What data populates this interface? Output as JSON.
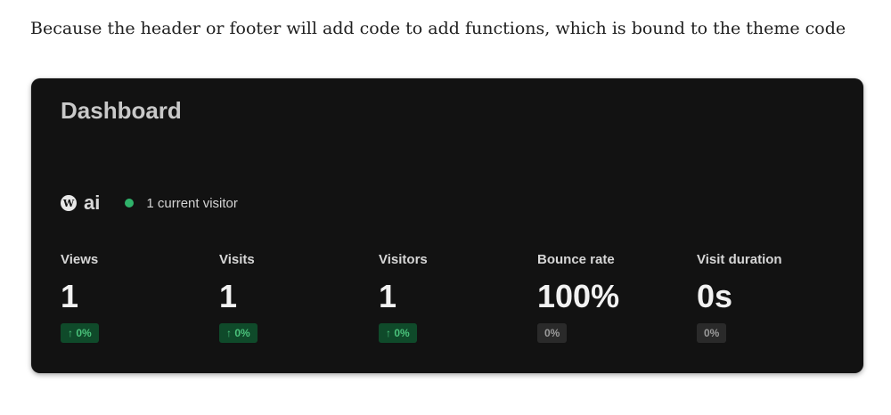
{
  "intro_text": "Because the header or footer will add code to add functions, which is bound to the theme code",
  "dashboard": {
    "title": "Dashboard",
    "site": {
      "icon": "wordpress-icon",
      "name": "ai"
    },
    "live": {
      "dot_color": "#2fb26a",
      "text": "1 current visitor"
    },
    "stats": [
      {
        "label": "Views",
        "value": "1",
        "change": "↑ 0%",
        "trend": "up"
      },
      {
        "label": "Visits",
        "value": "1",
        "change": "↑ 0%",
        "trend": "up"
      },
      {
        "label": "Visitors",
        "value": "1",
        "change": "↑ 0%",
        "trend": "up"
      },
      {
        "label": "Bounce rate",
        "value": "100%",
        "change": "0%",
        "trend": "neutral"
      },
      {
        "label": "Visit duration",
        "value": "0s",
        "change": "0%",
        "trend": "neutral"
      }
    ]
  },
  "colors": {
    "card_background": "#121212",
    "positive_badge_bg": "#0f4a2a",
    "positive_badge_text": "#4ac27b",
    "neutral_badge_bg": "#2a2a2a",
    "neutral_badge_text": "#9a9a9a"
  }
}
